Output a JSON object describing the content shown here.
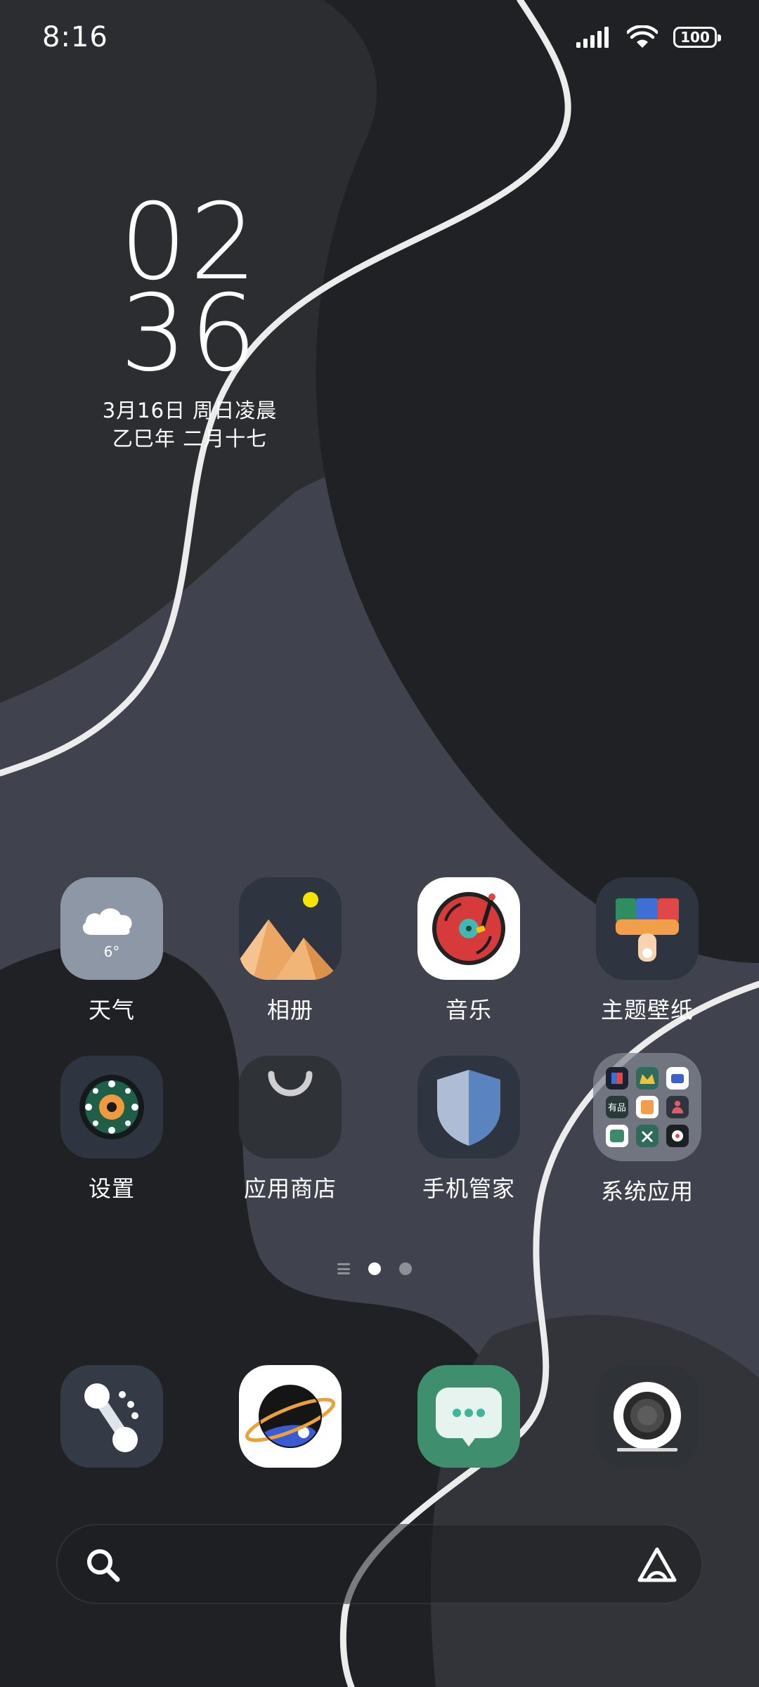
{
  "status_bar": {
    "time": "8:16",
    "battery": "100",
    "icons": [
      "signal-icon",
      "wifi-icon",
      "battery-icon"
    ]
  },
  "clock": {
    "hours": "02",
    "minutes": "36",
    "date": "3月16日 周日凌晨",
    "lunar": "乙巳年 二月十七"
  },
  "apps": [
    {
      "name": "weather",
      "label": "天气",
      "badge": "6°"
    },
    {
      "name": "gallery",
      "label": "相册"
    },
    {
      "name": "music",
      "label": "音乐"
    },
    {
      "name": "themes",
      "label": "主题壁纸"
    },
    {
      "name": "settings",
      "label": "设置"
    },
    {
      "name": "app-store",
      "label": "应用商店"
    },
    {
      "name": "security",
      "label": "手机管家"
    },
    {
      "name": "system-apps-folder",
      "label": "系统应用",
      "folder_tile_text": "有品"
    }
  ],
  "page_indicator": {
    "pages": 2,
    "active": 0
  },
  "dock": [
    {
      "name": "phone",
      "icon": "phone-icon"
    },
    {
      "name": "browser",
      "icon": "planet-browser-icon"
    },
    {
      "name": "messages",
      "icon": "message-icon"
    },
    {
      "name": "camera",
      "icon": "camera-icon"
    }
  ],
  "search": {
    "placeholder": "",
    "icons": [
      "search-icon",
      "assistant-icon"
    ]
  },
  "colors": {
    "wallpaper_dark": "#1f2023",
    "wallpaper_mid": "#2b2c30",
    "wallpaper_slate": "#3f424d",
    "accent_green": "#3f8f6f"
  }
}
